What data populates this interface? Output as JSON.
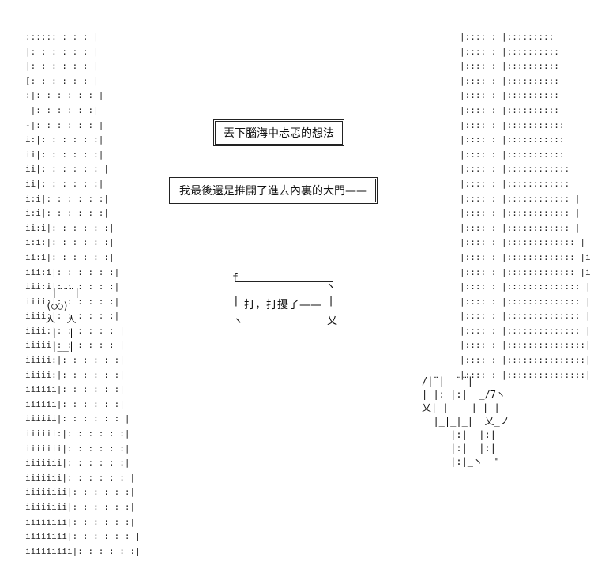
{
  "captions": {
    "first": "丟下腦海中忐忑的想法",
    "second": "我最後還是推開了進去內裏的大門——"
  },
  "speech": {
    "text": "打，打擾了——"
  },
  "art": {
    "left_wall_rows": [
      ":::::: : : : |",
      "|: : : : : : |",
      "|: : : : : : |",
      "[: : : : : : |",
      ":|: : : : : : |",
      "_|: : : : : :|",
      "-|: : : : : : |",
      "i:|: : : : : :|",
      "ii|: : : : : :|",
      "ii|: : : : : : |",
      "ii|: : : : : :|",
      "i:i|: : : : : :|",
      "i:i|: : : : : :|",
      "ii:i|: : : : : :|",
      "i:i:|: : : : : :|",
      "ii:i|: : : : : :|",
      "iii:i|: : : : : :|",
      "iii:i|: : : : : :|",
      "iiii:|: : : : : :|",
      "iiii:|: : : : : :|",
      "iiii:|: : : : : : |",
      "iiiii|: : : : : : |",
      "iiiii:|: : : : : :|",
      "iiiii:|: : : : : :|",
      "iiiiii|: : : : : :|",
      "iiiiii|: : : : : :|",
      "iiiiii|: : : : : : |",
      "iiiiii:|: : : : : :|",
      "iiiiiii|: : : : : :|",
      "iiiiiii|: : : : : :|",
      "iiiiiii|: : : : : : |",
      "iiiiiiii|: : : : : :|",
      "iiiiiiii|: : : : : :|",
      "iiiiiiii|: : : : : :|",
      "iiiiiiii|: : : : : : |",
      "iiiiiiiii|: : : : : :|"
    ],
    "right_wall_rows": [
      "|:::: : |:::::::::",
      "|:::: : |::::::::::",
      "|:::: : |::::::::::",
      "|:::: : |::::::::::",
      "|:::: : |::::::::::",
      "|:::: : |::::::::::",
      "|:::: : |:::::::::::",
      "|:::: : |:::::::::::",
      "|:::: : |:::::::::::",
      "|:::: : |::::::::::::",
      "|:::: : |::::::::::::",
      "|:::: : |:::::::::::: |",
      "|:::: : |:::::::::::: |",
      "|:::: : |:::::::::::: |",
      "|:::: : |::::::::::::: |",
      "|:::: : |::::::::::::: |i",
      "|:::: : |::::::::::::: |i",
      "|:::: : |:::::::::::::: |i",
      "|:::: : |:::::::::::::: |i",
      "|:::: : |:::::::::::::: |ii",
      "|:::: : |:::::::::::::: |ii",
      "|:::: : |:::::::::::::::|ii",
      "|:::: : |:::::::::::::::|iii",
      "|:::: : |:::::::::::::::|iii"
    ],
    "left_figure": " |¨¨¨|\n(◯◯)\n人  人\n |  |\n |__|",
    "right_figure": "/|¨|  ¨¨|\n| |: |:|  _/7ヽ\n乂|_|_|  |_| |\n  |_|_|_|  乂_ノ\n     |:|  |:|\n     |:|  |:|\n     |:|_ヽ-‐\""
  }
}
